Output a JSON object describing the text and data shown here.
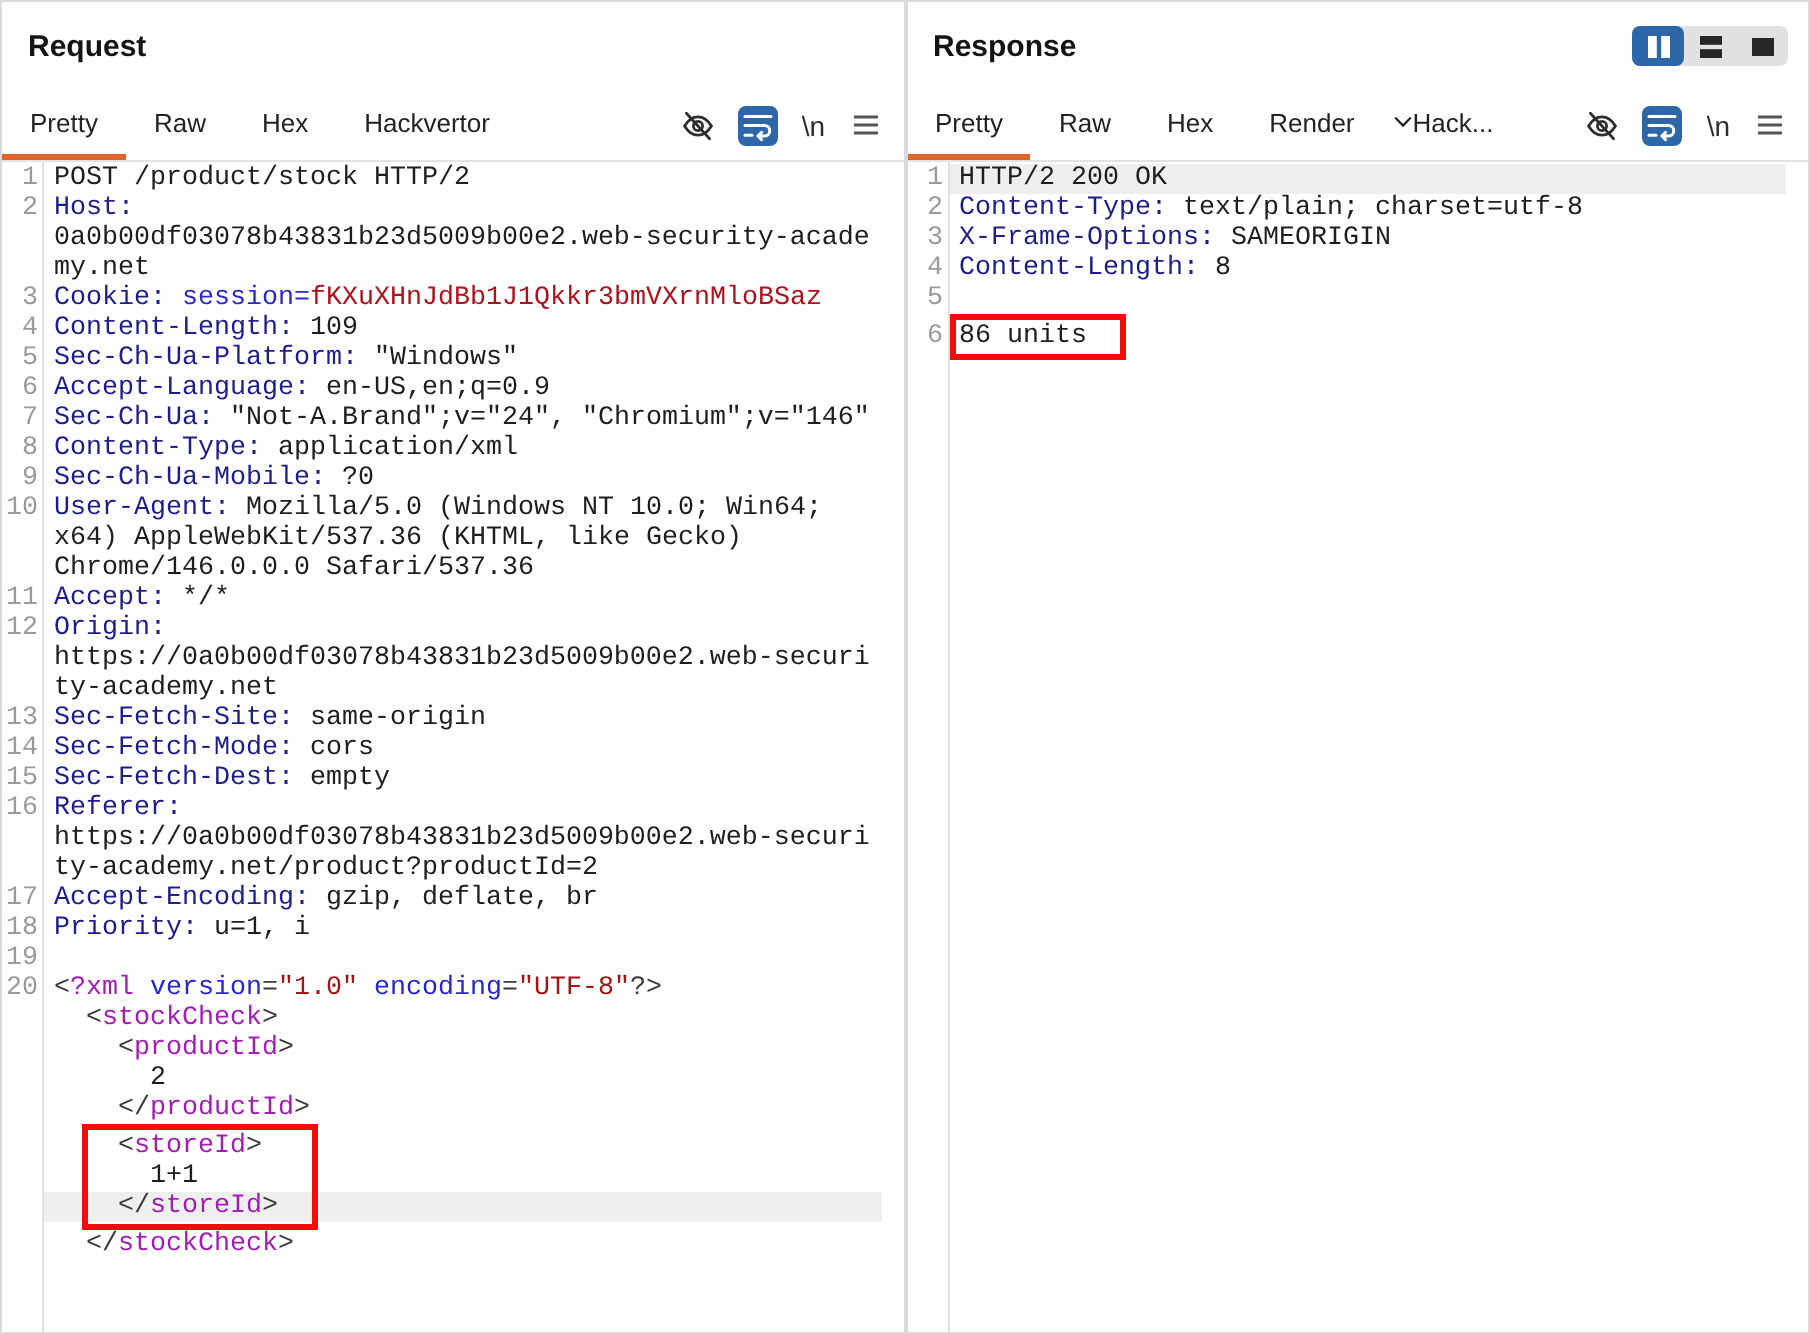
{
  "request": {
    "title": "Request",
    "tabs": [
      {
        "kind": "tab",
        "label": "Pretty",
        "selected": true
      },
      {
        "kind": "tab",
        "label": "Raw",
        "selected": false
      },
      {
        "kind": "tab",
        "label": "Hex",
        "selected": false
      },
      {
        "kind": "tab",
        "label": "Hackvertor",
        "selected": false
      }
    ],
    "tools": [
      {
        "kind": "hide",
        "on": false
      },
      {
        "kind": "wrap",
        "on": true
      },
      {
        "kind": "newline",
        "label": "\\n",
        "on": false
      },
      {
        "kind": "menu"
      }
    ],
    "lines": [
      {
        "number": "1",
        "current": false,
        "boxed": false,
        "segments": [
          {
            "kind": "plain",
            "text": "POST /product/stock HTTP/2"
          }
        ]
      },
      {
        "number": "2",
        "current": false,
        "boxed": false,
        "segments": [
          {
            "kind": "name",
            "text": "Host:"
          },
          {
            "kind": "plain",
            "text": " 0a0b00df03078b43831b23d5009b00e2.web-security-academy.net"
          }
        ]
      },
      {
        "number": "3",
        "current": false,
        "boxed": false,
        "segments": [
          {
            "kind": "name",
            "text": "Cookie:"
          },
          {
            "kind": "param",
            "text": " session="
          },
          {
            "kind": "value",
            "text": "fKXuXHnJdBb1J1Qkkr3bmVXrnMloBSaz"
          }
        ]
      },
      {
        "number": "4",
        "current": false,
        "boxed": false,
        "segments": [
          {
            "kind": "name",
            "text": "Content-Length:"
          },
          {
            "kind": "plain",
            "text": " 109"
          }
        ]
      },
      {
        "number": "5",
        "current": false,
        "boxed": false,
        "segments": [
          {
            "kind": "name",
            "text": "Sec-Ch-Ua-Platform:"
          },
          {
            "kind": "plain",
            "text": " \"Windows\""
          }
        ]
      },
      {
        "number": "6",
        "current": false,
        "boxed": false,
        "segments": [
          {
            "kind": "name",
            "text": "Accept-Language:"
          },
          {
            "kind": "plain",
            "text": " en-US,en;q=0.9"
          }
        ]
      },
      {
        "number": "7",
        "current": false,
        "boxed": false,
        "segments": [
          {
            "kind": "name",
            "text": "Sec-Ch-Ua:"
          },
          {
            "kind": "plain",
            "text": " \"Not-A.Brand\";v=\"24\", \"Chromium\";v=\"146\""
          }
        ]
      },
      {
        "number": "8",
        "current": false,
        "boxed": false,
        "segments": [
          {
            "kind": "name",
            "text": "Content-Type:"
          },
          {
            "kind": "plain",
            "text": " application/xml"
          }
        ]
      },
      {
        "number": "9",
        "current": false,
        "boxed": false,
        "segments": [
          {
            "kind": "name",
            "text": "Sec-Ch-Ua-Mobile:"
          },
          {
            "kind": "plain",
            "text": " ?0"
          }
        ]
      },
      {
        "number": "10",
        "current": false,
        "boxed": false,
        "segments": [
          {
            "kind": "name",
            "text": "User-Agent:"
          },
          {
            "kind": "plain",
            "text": " Mozilla/5.0 (Windows NT 10.0; Win64; x64) AppleWebKit/537.36 (KHTML, like Gecko) Chrome/146.0.0.0 Safari/537.36"
          }
        ]
      },
      {
        "number": "11",
        "current": false,
        "boxed": false,
        "segments": [
          {
            "kind": "name",
            "text": "Accept:"
          },
          {
            "kind": "plain",
            "text": " */*"
          }
        ]
      },
      {
        "number": "12",
        "current": false,
        "boxed": false,
        "segments": [
          {
            "kind": "name",
            "text": "Origin:"
          },
          {
            "kind": "plain",
            "text": " https://0a0b00df03078b43831b23d5009b00e2.web-security-academy.net"
          }
        ]
      },
      {
        "number": "13",
        "current": false,
        "boxed": false,
        "segments": [
          {
            "kind": "name",
            "text": "Sec-Fetch-Site:"
          },
          {
            "kind": "plain",
            "text": " same-origin"
          }
        ]
      },
      {
        "number": "14",
        "current": false,
        "boxed": false,
        "segments": [
          {
            "kind": "name",
            "text": "Sec-Fetch-Mode:"
          },
          {
            "kind": "plain",
            "text": " cors"
          }
        ]
      },
      {
        "number": "15",
        "current": false,
        "boxed": false,
        "segments": [
          {
            "kind": "name",
            "text": "Sec-Fetch-Dest:"
          },
          {
            "kind": "plain",
            "text": " empty"
          }
        ]
      },
      {
        "number": "16",
        "current": false,
        "boxed": false,
        "segments": [
          {
            "kind": "name",
            "text": "Referer:"
          },
          {
            "kind": "plain",
            "text": " https://0a0b00df03078b43831b23d5009b00e2.web-security-academy.net/product?productId=2"
          }
        ]
      },
      {
        "number": "17",
        "current": false,
        "boxed": false,
        "segments": [
          {
            "kind": "name",
            "text": "Accept-Encoding:"
          },
          {
            "kind": "plain",
            "text": " gzip, deflate, br"
          }
        ]
      },
      {
        "number": "18",
        "current": false,
        "boxed": false,
        "segments": [
          {
            "kind": "name",
            "text": "Priority:"
          },
          {
            "kind": "plain",
            "text": " u=1, i"
          }
        ]
      },
      {
        "number": "19",
        "current": false,
        "boxed": false
      },
      {
        "number": "20",
        "current": false,
        "boxed": false,
        "segments": [
          {
            "kind": "punct",
            "text": "<"
          },
          {
            "kind": "tag",
            "text": "?xml"
          },
          {
            "kind": "attr",
            "text": " version"
          },
          {
            "kind": "punct",
            "text": "="
          },
          {
            "kind": "string",
            "text": "\"1.0\""
          },
          {
            "kind": "attr",
            "text": " encoding"
          },
          {
            "kind": "punct",
            "text": "="
          },
          {
            "kind": "string",
            "text": "\"UTF-8\""
          },
          {
            "kind": "punct",
            "text": "?>"
          }
        ]
      },
      {
        "current": false,
        "boxed": false,
        "segments": [
          {
            "kind": "punct",
            "text": "  <"
          },
          {
            "kind": "tag",
            "text": "stockCheck"
          },
          {
            "kind": "punct",
            "text": ">"
          }
        ]
      },
      {
        "current": false,
        "boxed": false,
        "segments": [
          {
            "kind": "punct",
            "text": "    <"
          },
          {
            "kind": "tag",
            "text": "productId"
          },
          {
            "kind": "punct",
            "text": ">"
          }
        ]
      },
      {
        "current": false,
        "boxed": false,
        "segments": [
          {
            "kind": "plain",
            "text": "      2"
          }
        ]
      },
      {
        "current": false,
        "boxed": false,
        "segments": [
          {
            "kind": "punct",
            "text": "    </"
          },
          {
            "kind": "tag",
            "text": "productId"
          },
          {
            "kind": "punct",
            "text": ">"
          }
        ]
      },
      {
        "current": false,
        "boxed": true,
        "segments": [
          {
            "kind": "punct",
            "text": "    <"
          },
          {
            "kind": "tag",
            "text": "storeId"
          },
          {
            "kind": "punct",
            "text": ">"
          }
        ]
      },
      {
        "current": false,
        "boxed": true,
        "segments": [
          {
            "kind": "plain",
            "text": "      1+1"
          }
        ]
      },
      {
        "current": true,
        "boxed": true,
        "segments": [
          {
            "kind": "punct",
            "text": "    </"
          },
          {
            "kind": "tag",
            "text": "storeId"
          },
          {
            "kind": "punct",
            "text": ">"
          }
        ]
      },
      {
        "current": false,
        "boxed": false,
        "segments": [
          {
            "kind": "punct",
            "text": "  </"
          },
          {
            "kind": "tag",
            "text": "stockCheck"
          },
          {
            "kind": "punct",
            "text": ">"
          }
        ]
      }
    ]
  },
  "response": {
    "title": "Response",
    "layout": [
      {
        "kind": "columns",
        "selected": true
      },
      {
        "kind": "rows",
        "selected": false
      },
      {
        "kind": "single",
        "selected": false
      }
    ],
    "tabs": [
      {
        "kind": "tab",
        "label": "Pretty",
        "selected": true
      },
      {
        "kind": "tab",
        "label": "Raw",
        "selected": false
      },
      {
        "kind": "tab",
        "label": "Hex",
        "selected": false
      },
      {
        "kind": "tab",
        "label": "Render",
        "selected": false
      },
      {
        "kind": "dropdown",
        "label": "Hack...",
        "selected": false
      }
    ],
    "tools": [
      {
        "kind": "hide",
        "on": false
      },
      {
        "kind": "wrap",
        "on": true
      },
      {
        "kind": "newline",
        "label": "\\n",
        "on": false
      },
      {
        "kind": "menu"
      }
    ],
    "lines": [
      {
        "number": "1",
        "current": true,
        "boxed": false,
        "segments": [
          {
            "kind": "plain",
            "text": "HTTP/2 200 OK"
          }
        ]
      },
      {
        "number": "2",
        "current": false,
        "boxed": false,
        "segments": [
          {
            "kind": "name",
            "text": "Content-Type:"
          },
          {
            "kind": "plain",
            "text": " text/plain; charset=utf-8"
          }
        ]
      },
      {
        "number": "3",
        "current": false,
        "boxed": false,
        "segments": [
          {
            "kind": "name",
            "text": "X-Frame-Options:"
          },
          {
            "kind": "plain",
            "text": " SAMEORIGIN"
          }
        ]
      },
      {
        "number": "4",
        "current": false,
        "boxed": false,
        "segments": [
          {
            "kind": "name",
            "text": "Content-Length:"
          },
          {
            "kind": "plain",
            "text": " 8"
          }
        ]
      },
      {
        "number": "5",
        "current": false,
        "boxed": false
      },
      {
        "number": "6",
        "current": false,
        "boxed": true,
        "segments": [
          {
            "kind": "plain",
            "text": "86 units"
          }
        ]
      }
    ]
  }
}
